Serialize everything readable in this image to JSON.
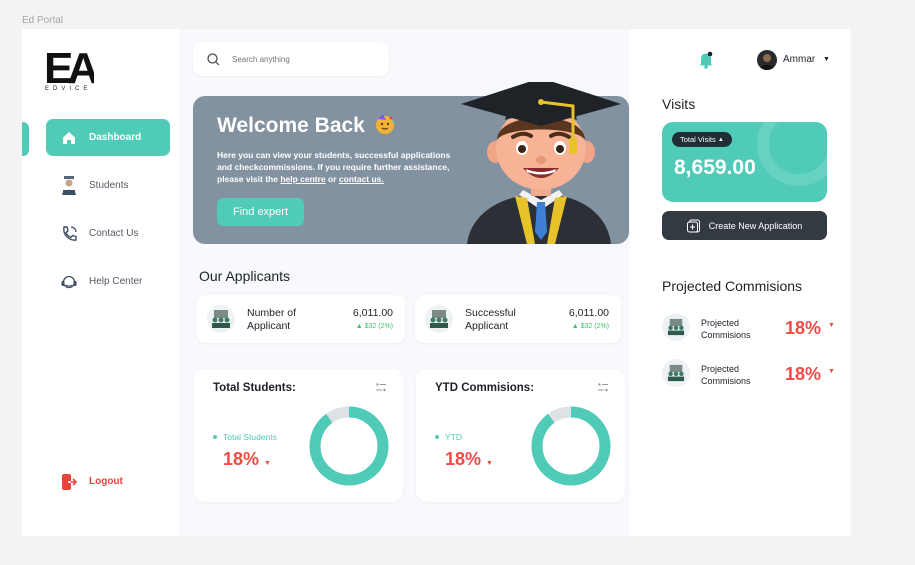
{
  "app": {
    "title": "Ed Portal",
    "brand": "EA",
    "brand_sub": "EDVICE"
  },
  "colors": {
    "accent": "#4fcbb8",
    "danger": "#ef4b44",
    "banner": "#8392a0",
    "dark": "#343a42"
  },
  "sidebar": {
    "items": [
      {
        "label": "Dashboard",
        "icon": "home-icon",
        "active": true
      },
      {
        "label": "Students",
        "icon": "student-icon"
      },
      {
        "label": "Contact Us",
        "icon": "phone-icon"
      },
      {
        "label": "Help Center",
        "icon": "headset-icon"
      }
    ],
    "logout": {
      "label": "Logout",
      "icon": "logout-icon"
    }
  },
  "search": {
    "placeholder": "Search anything"
  },
  "banner": {
    "title": "Welcome Back",
    "text_1": "Here you can view your students, successful applications and checkcommissions. If you require further assistance, please visit the ",
    "link_help": "help centre",
    "text_or": " or ",
    "link_contact": "contact us.",
    "button": "Find expert"
  },
  "applicants": {
    "title": "Our Applicants",
    "cards": [
      {
        "label": "Number of Applicant",
        "value": "6,011.00",
        "change": "$32 (2%)"
      },
      {
        "label": "Successful Applicant",
        "value": "6,011.00",
        "change": "$32 (2%)"
      }
    ]
  },
  "stats": [
    {
      "title": "Total Students:",
      "legend": "Total Students",
      "value": "18%",
      "fill": 0.9
    },
    {
      "title": "YTD Commisions:",
      "legend": "YTD",
      "value": "18%",
      "fill": 0.9
    }
  ],
  "user": {
    "name": "Ammar"
  },
  "visits": {
    "title": "Visits",
    "badge": "Total Visits",
    "value": "8,659.00",
    "button": "Create New Application"
  },
  "projected": {
    "title": "Projected Commisions",
    "rows": [
      {
        "label_1": "Projected",
        "label_2": "Commisions",
        "value": "18%"
      },
      {
        "label_1": "Projected",
        "label_2": "Commisions",
        "value": "18%"
      }
    ]
  }
}
